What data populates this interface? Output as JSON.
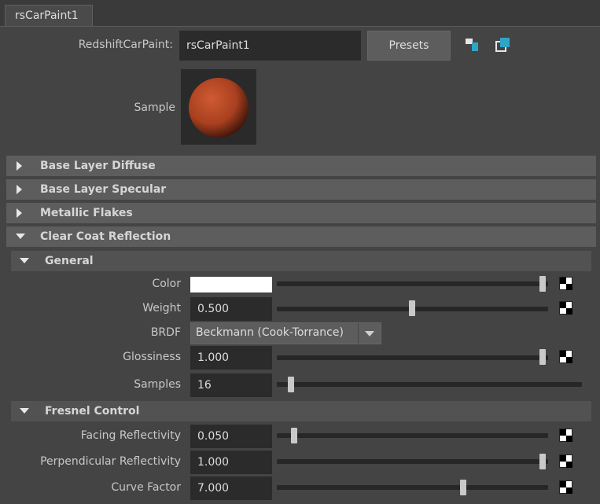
{
  "tab": {
    "label": "rsCarPaint1"
  },
  "header": {
    "node_type_label": "RedshiftCarPaint:",
    "node_name": "rsCarPaint1",
    "presets_label": "Presets",
    "icons": [
      "show-input-output-icon",
      "copy-tab-icon"
    ],
    "accent_color": "#2fa5c6"
  },
  "sample": {
    "label": "Sample",
    "swatch_color": "#b0462a"
  },
  "sections": {
    "base_diffuse": "Base Layer Diffuse",
    "base_specular": "Base Layer Specular",
    "metallic_flakes": "Metallic Flakes",
    "clear_coat": "Clear Coat Reflection"
  },
  "general": {
    "title": "General",
    "color": {
      "label": "Color",
      "value_color": "#ffffff",
      "slider_fraction": 1.0
    },
    "weight": {
      "label": "Weight",
      "value": "0.500",
      "slider_fraction": 0.5
    },
    "brdf": {
      "label": "BRDF",
      "value": "Beckmann (Cook-Torrance)"
    },
    "glossiness": {
      "label": "Glossiness",
      "value": "1.000",
      "slider_fraction": 1.0
    },
    "samples": {
      "label": "Samples",
      "value": "16",
      "slider_fraction": 0.02
    }
  },
  "fresnel": {
    "title": "Fresnel Control",
    "facing": {
      "label": "Facing Reflectivity",
      "value": "0.050",
      "slider_fraction": 0.05
    },
    "perpendicular": {
      "label": "Perpendicular Reflectivity",
      "value": "1.000",
      "slider_fraction": 1.0
    },
    "curve": {
      "label": "Curve Factor",
      "value": "7.000",
      "slider_fraction": 0.7
    }
  }
}
